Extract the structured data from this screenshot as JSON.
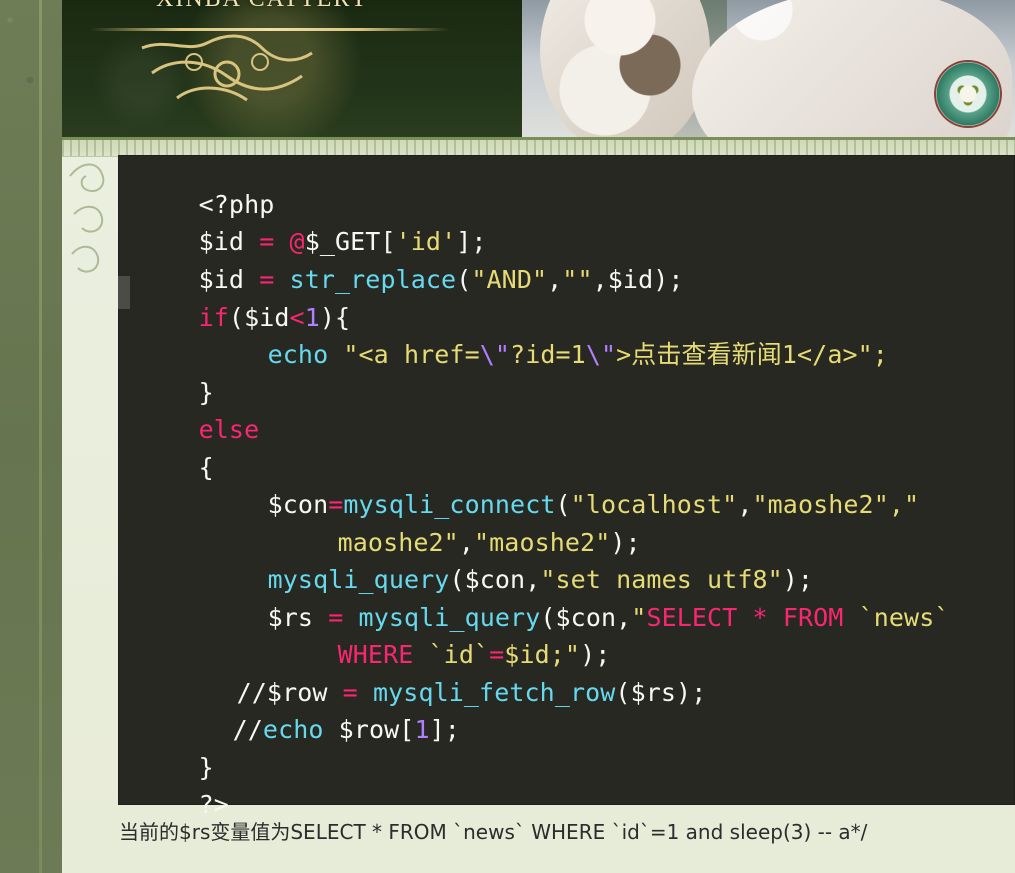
{
  "header": {
    "cattery_title": "XINBA CATTERY"
  },
  "code": {
    "line_1": "<?php",
    "line_2": {
      "a": "$id",
      "b": " = ",
      "c": "@",
      "d": "$_GET",
      "e": "[",
      "f": "'id'",
      "g": "];"
    },
    "line_3": {
      "a": "$id",
      "b": " = ",
      "c": "str_replace",
      "d": "(",
      "e": "\"AND\"",
      "f": ",",
      "g": "\"\"",
      "h": ",",
      "i": "$id",
      "j": ");"
    },
    "line_4": {
      "a": "if",
      "b": "(",
      "c": "$id",
      "d": "<",
      "e": "1",
      "f": "){"
    },
    "line_5": {
      "a": "echo",
      "b": " \"<a href=",
      "c": "\\\"",
      "d": "?id=1",
      "e": "\\\"",
      "f": ">点击查看新闻1</a>\";"
    },
    "line_6": "}",
    "line_7": "else",
    "line_8": "{",
    "line_9": {
      "a": "$con",
      "b": "=",
      "c": "mysqli_connect",
      "d": "(",
      "e": "\"localhost\"",
      "f": ",",
      "g": "\"maoshe2\"",
      "h": ",\""
    },
    "line_10": {
      "a": "maoshe2\"",
      "b": ",",
      "c": "\"maoshe2\"",
      "d": ");"
    },
    "line_11": {
      "a": "mysqli_query",
      "b": "(",
      "c": "$con",
      "d": ",",
      "e": "\"set names utf8\"",
      "f": ");"
    },
    "line_12": {
      "a": "$rs",
      "b": " = ",
      "c": "mysqli_query",
      "d": "(",
      "e": "$con",
      "f": ",",
      "g": "\"",
      "h": "SELECT",
      "i": " * ",
      "j": "FROM",
      "k": " `news`"
    },
    "line_13": {
      "a": "WHERE",
      "b": " `id`",
      "c": "=",
      "d": "$id;\"",
      "e": ");"
    },
    "line_14": {
      "a": "//",
      "b": "$row",
      "c": " = ",
      "d": "mysqli_fetch_row",
      "e": "(",
      "f": "$rs",
      "g": ");"
    },
    "line_15": {
      "a": "//",
      "b": "echo",
      "c": " $row",
      "d": "[",
      "e": "1",
      "f": "];"
    },
    "line_16": "}",
    "line_17": "?>"
  },
  "status": {
    "message": "当前的$rs变量值为SELECT * FROM `news` WHERE `id`=1 and sleep(3) -- a*/"
  },
  "colors": {
    "code_background": "#272822",
    "keyword_pink": "#f92672",
    "string_yellow": "#e6db74",
    "function_cyan": "#66d9ef",
    "number_purple": "#ae81ff"
  }
}
